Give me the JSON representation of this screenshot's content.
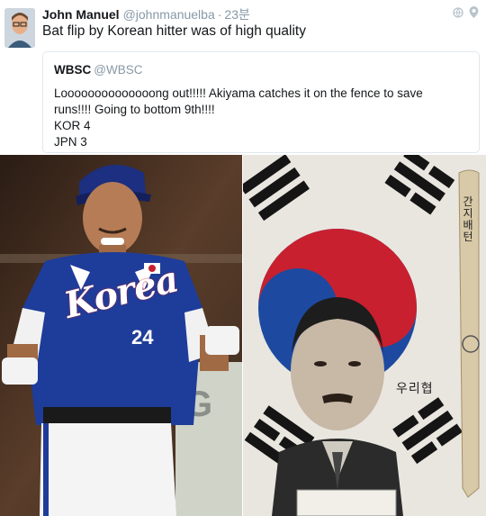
{
  "tweet": {
    "author_name": "John Manuel",
    "author_handle": "@johnmanuelba",
    "time": "23분",
    "text": "Bat flip by Korean hitter was of high quality"
  },
  "quoted": {
    "name": "WBSC",
    "handle": "@WBSC",
    "lines": [
      "Loooooooooooooong out!!!!! Akiyama catches it on the fence to save",
      "runs!!!! Going to bottom 9th!!!!",
      "KOR 4",
      "JPN 3"
    ]
  },
  "photo_left": {
    "jersey_text": "Korea",
    "jersey_number": "24"
  },
  "photo_right": {
    "bat_text": "간지\n배턴",
    "caption_text": "우리협"
  },
  "colors": {
    "jersey_blue": "#1e3c9a",
    "flag_red": "#c8202f",
    "flag_blue": "#1d4aa0",
    "text_gray": "#8899a6"
  },
  "icons": [
    "globe-icon",
    "location-pin-icon",
    "avatar-photo"
  ]
}
